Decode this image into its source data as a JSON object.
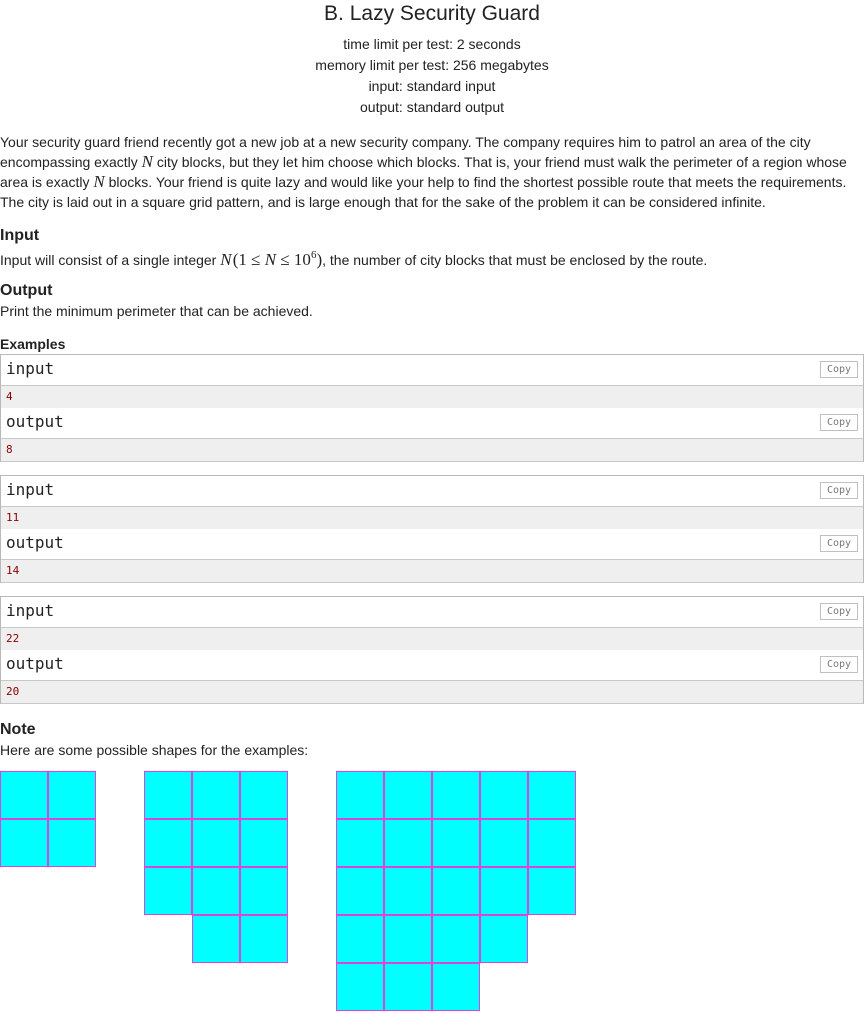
{
  "problem": {
    "title": "B. Lazy Security Guard",
    "time_limit": "time limit per test: 2 seconds",
    "memory_limit": "memory limit per test: 256 megabytes",
    "input_file": "input: standard input",
    "output_file": "output: standard output"
  },
  "statement": {
    "p1": "Your security guard friend recently got a new job at a new security company. The company requires him to patrol an area of the city encompassing exactly ",
    "var_n": "N",
    "p2": " city blocks, but they let him choose which blocks. That is, your friend must walk the perimeter of a region whose area is exactly ",
    "p3": " blocks. Your friend is quite lazy and would like your help to find the shortest possible route that meets the requirements. The city is laid out in a square grid pattern, and is large enough that for the sake of the problem it can be considered infinite."
  },
  "input_section": {
    "title": "Input",
    "text_before": "Input will consist of a single integer ",
    "constraint_open": "(1 ≤ ",
    "constraint_mid": " ≤ 10",
    "constraint_exp": "6",
    "constraint_close": ")",
    "text_after": ", the number of city blocks that must be enclosed by the route."
  },
  "output_section": {
    "title": "Output",
    "text": "Print the minimum perimeter that can be achieved."
  },
  "examples": {
    "title": "Examples",
    "copy_label": "Copy",
    "input_label": "input",
    "output_label": "output",
    "items": [
      {
        "input": "4",
        "output": "8"
      },
      {
        "input": "11",
        "output": "14"
      },
      {
        "input": "22",
        "output": "20"
      }
    ]
  },
  "note": {
    "title": "Note",
    "text": "Here are some possible shapes for the examples:",
    "shape_fill": "#00ffff",
    "shape_border": "#e040e0",
    "shapes": [
      {
        "rows": [
          "XX",
          "XX"
        ]
      },
      {
        "rows": [
          "XXX",
          "XXX",
          "XXX",
          ".XX"
        ]
      },
      {
        "rows": [
          "XXXXX",
          "XXXXX",
          "XXXXX",
          "XXXX.",
          "XXX.."
        ]
      }
    ]
  }
}
